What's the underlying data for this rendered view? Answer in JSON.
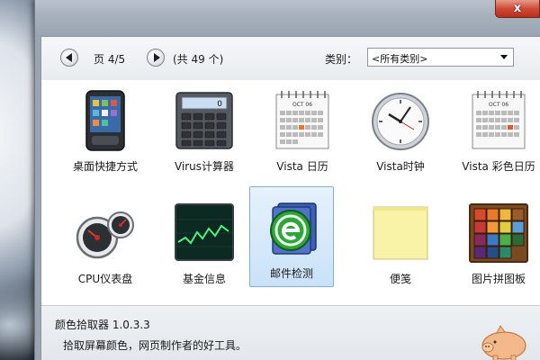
{
  "window": {
    "close_label": "x"
  },
  "toolbar": {
    "page_label": "页 4/5",
    "total_label": "(共 49 个)",
    "category_label": "类别：",
    "category_value": "<所有类别>"
  },
  "gadgets": [
    {
      "label": "桌面快捷方式",
      "icon": "phone-shortcut-icon"
    },
    {
      "label": "Virus计算器",
      "icon": "calculator-icon"
    },
    {
      "label": "Vista 日历",
      "icon": "calendar-icon"
    },
    {
      "label": "Vista时钟",
      "icon": "clock-icon"
    },
    {
      "label": "Vista 彩色日历",
      "icon": "color-calendar-icon"
    },
    {
      "label": "CPU仪表盘",
      "icon": "cpu-gauge-icon"
    },
    {
      "label": "基金信息",
      "icon": "stock-chart-icon"
    },
    {
      "label": "邮件检测",
      "icon": "mail-check-icon",
      "selected": true
    },
    {
      "label": "便笺",
      "icon": "sticky-note-icon"
    },
    {
      "label": "图片拼图板",
      "icon": "picture-puzzle-icon"
    }
  ],
  "calculator_display": "0",
  "calendar_month": "OCT 06",
  "footer": {
    "title": "颜色拾取器 1.0.3.3",
    "description": "拾取屏幕颜色，网页制作者的好工具。"
  },
  "colors": {
    "accent": "#7fb0de",
    "close_red": "#cf4b36"
  }
}
